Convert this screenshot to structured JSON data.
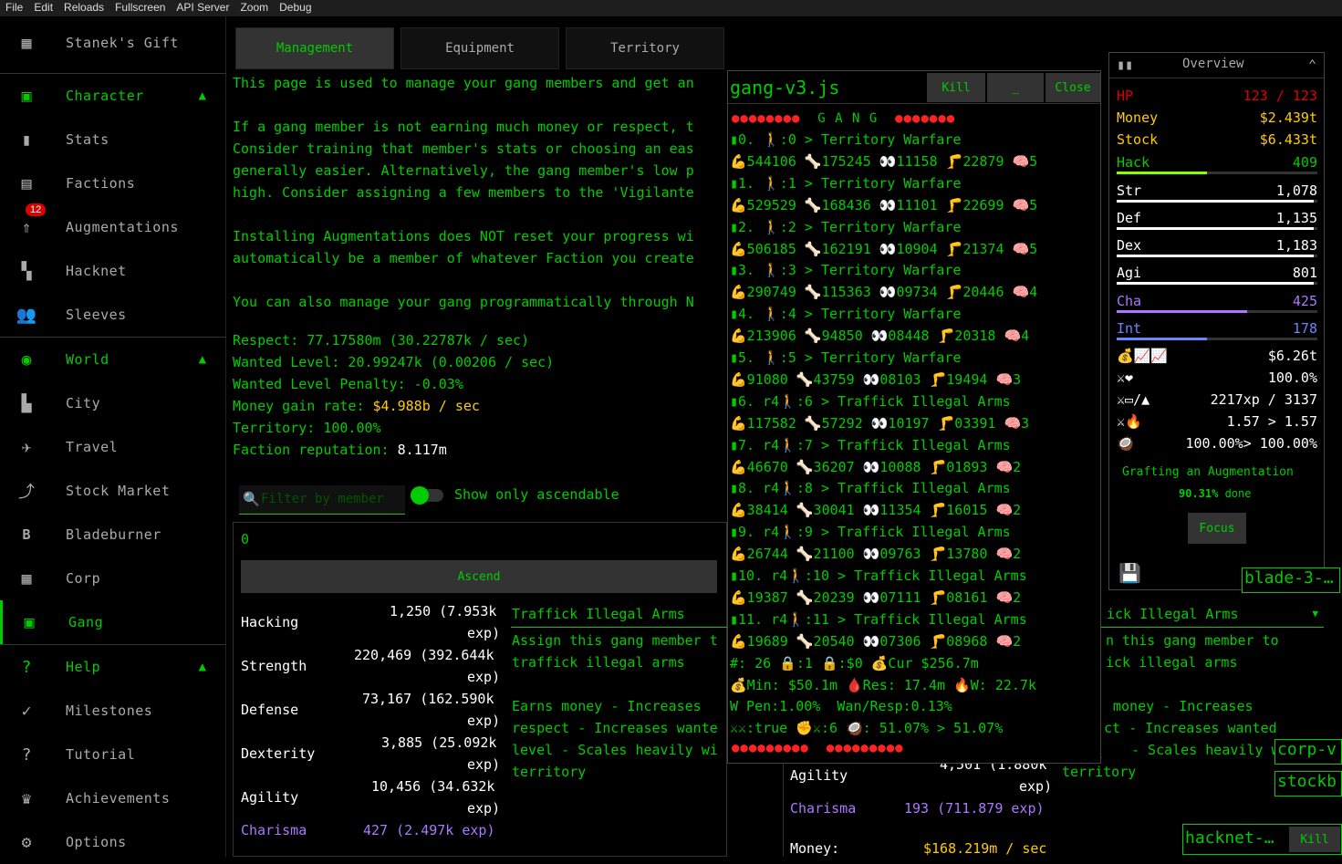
{
  "menubar": [
    "File",
    "Edit",
    "Reloads",
    "Fullscreen",
    "API Server",
    "Zoom",
    "Debug"
  ],
  "sidebar": {
    "top": "Stanek's Gift",
    "character": "Character",
    "stats": "Stats",
    "factions": "Factions",
    "augmentations": "Augmentations",
    "aug_badge": "12",
    "hacknet": "Hacknet",
    "sleeves": "Sleeves",
    "world": "World",
    "city": "City",
    "travel": "Travel",
    "stock": "Stock Market",
    "bladeburner": "Bladeburner",
    "corp": "Corp",
    "gang": "Gang",
    "help": "Help",
    "milestones": "Milestones",
    "tutorial": "Tutorial",
    "achievements": "Achievements",
    "options": "Options"
  },
  "tabs": [
    "Management",
    "Equipment",
    "Territory"
  ],
  "intro": [
    "This page is used to manage your gang members and get an",
    "If a gang member is not earning much money or respect, t",
    "Consider training that member's stats or choosing an eas",
    "generally easier. Alternatively, the gang member's low p",
    "high. Consider assigning a few members to the 'Vigilante",
    "Installing Augmentations does NOT reset your progress wi",
    "automatically be a member of whatever Faction you create",
    "You can also manage your gang programmatically through N"
  ],
  "stats": {
    "respect": "Respect: 77.17580m (30.22787k / sec)",
    "wanted": "Wanted Level: 20.99247k (0.00206 / sec)",
    "penalty": "Wanted Level Penalty: -0.03%",
    "money_label": "Money gain rate: ",
    "money_val": "$4.988b / sec",
    "territory": "Territory: 100.00%",
    "rep_label": "Faction reputation: ",
    "rep_val": "8.117m"
  },
  "filter": {
    "placeholder": "Filter by member",
    "ascendable": "Show only ascendable"
  },
  "member": {
    "name": "0",
    "ascend": "Ascend",
    "rows": [
      [
        "Hacking",
        "1,250 (7.953k",
        "exp)"
      ],
      [
        "Strength",
        "220,469 (392.644k",
        "exp)"
      ],
      [
        "Defense",
        "73,167 (162.590k",
        "exp)"
      ],
      [
        "Dexterity",
        "3,885 (25.092k",
        "exp)"
      ],
      [
        "Agility",
        "10,456 (34.632k",
        "exp)"
      ]
    ],
    "charisma": "Charisma",
    "charisma_val": "427 (2.497k exp)",
    "task": "Traffick Illegal Arms",
    "desc": [
      "Assign this gang member t",
      "traffick illegal arms"
    ],
    "desc2": [
      "Earns money - Increases",
      "respect - Increases wante",
      "level - Scales heavily wi",
      "territory"
    ]
  },
  "member2": {
    "task": "ick Illegal Arms",
    "desc": [
      "n this gang member to",
      "ick illegal arms"
    ],
    "desc2": [
      "money - Increases",
      "ct - Increases wanted",
      "- Scales heavily w",
      "territory"
    ],
    "agility": "Agility",
    "agility_val": "4,501 (1.880k",
    "agility_exp": "exp)",
    "charisma": "Charisma",
    "charisma_val": "193 (711.879 exp)",
    "money_label": "Money:",
    "money_val": "$168.219m / sec"
  },
  "script": {
    "title": "gang-v3.js",
    "kill": "Kill",
    "min": "_",
    "close": "Close",
    "gang": "G A N G",
    "lines": [
      "▮0. 🚶:0 > Territory Warfare",
      "💪544106 🦴175245 👀11158 🦵22879 🧠5",
      "▮1. 🚶:1 > Territory Warfare",
      "💪529529 🦴168436 👀11101 🦵22699 🧠5",
      "▮2. 🚶:2 > Territory Warfare",
      "💪506185 🦴162191 👀10904 🦵21374 🧠5",
      "▮3. 🚶:3 > Territory Warfare",
      "💪290749 🦴115363 👀09734 🦵20446 🧠4",
      "▮4. 🚶:4 > Territory Warfare",
      "💪213906 🦴94850 👀08448 🦵20318 🧠4",
      "▮5. 🚶:5 > Territory Warfare",
      "💪91080 🦴43759 👀08103 🦵19494 🧠3",
      "▮6. r4🚶:6 > Traffick Illegal Arms",
      "💪117582 🦴57292 👀10197 🦵03391 🧠3",
      "▮7. r4🚶:7 > Traffick Illegal Arms",
      "💪46670 🦴36207 👀10088 🦵01893 🧠2",
      "▮8. r4🚶:8 > Traffick Illegal Arms",
      "💪38414 🦴30041 👀11354 🦵16015 🧠2",
      "▮9. r4🚶:9 > Traffick Illegal Arms",
      "💪26744 🦴21100 👀09763 🦵13780 🧠2",
      "▮10. r4🚶:10 > Traffick Illegal Arms",
      "💪19387 🦴20239 👀07111 🦵08161 🧠2",
      "▮11. r4🚶:11 > Traffick Illegal Arms",
      "💪19689 🦴20540 👀07306 🦵08968 🧠2",
      "#: 26 🔒:1 🔒:$0 💰Cur $256.7m",
      "💰Min: $50.1m 🩸Res: 17.4m 🔥W: 22.7k",
      "W Pen:1.00%  Wan/Resp:0.13%",
      "⚔⚔:true ✊⚔:6 🥥: 51.07% > 51.07%"
    ]
  },
  "overview": {
    "title": "Overview",
    "hp_l": "HP",
    "hp_v": "123 / 123",
    "money_l": "Money",
    "money_v": "$2.439t",
    "stock_l": "Stock",
    "stock_v": "$6.433t",
    "hack_l": "Hack",
    "hack_v": "409",
    "str_l": "Str",
    "str_v": "1,078",
    "def_l": "Def",
    "def_v": "1,135",
    "dex_l": "Dex",
    "dex_v": "1,183",
    "agi_l": "Agi",
    "agi_v": "801",
    "cha_l": "Cha",
    "cha_v": "425",
    "int_l": "Int",
    "int_v": "178",
    "r1": "$6.26t",
    "r2": "100.0%",
    "r3": "2217xp / 3137",
    "r4": "1.57 > 1.57",
    "r5": "100.00%> 100.00%",
    "graft": "Grafting an Augmentation",
    "graft_pct": "90.31%",
    "graft_done": " done",
    "focus": "Focus"
  },
  "tails": {
    "blade": "blade-3-…",
    "corp": "corp-v",
    "stock": "stockb",
    "hacknet": "hacknet-…",
    "kill": "Kill"
  }
}
